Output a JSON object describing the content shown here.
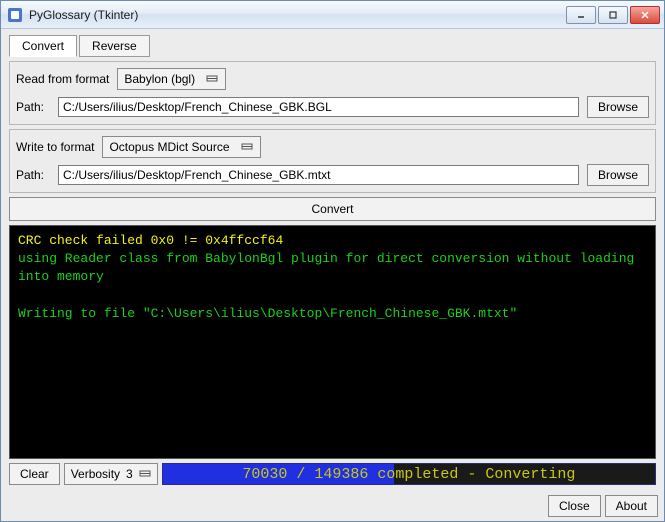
{
  "window": {
    "title": "PyGlossary (Tkinter)"
  },
  "tabs": {
    "convert": "Convert",
    "reverse": "Reverse"
  },
  "read": {
    "label": "Read from format",
    "format": "Babylon (bgl)",
    "path_label": "Path:",
    "path": "C:/Users/ilius/Desktop/French_Chinese_GBK.BGL",
    "browse": "Browse"
  },
  "write": {
    "label": "Write to format",
    "format": "Octopus MDict Source",
    "path_label": "Path:",
    "path": "C:/Users/ilius/Desktop/French_Chinese_GBK.mtxt",
    "browse": "Browse"
  },
  "convert_button": "Convert",
  "console": {
    "line1": "CRC check failed 0x0 != 0x4ffccf64",
    "line2": "using Reader class from BabylonBgl plugin for direct conversion without loading into memory",
    "line3": "Writing to file \"C:\\Users\\ilius\\Desktop\\French_Chinese_GBK.mtxt\""
  },
  "bottom": {
    "clear": "Clear",
    "verbosity_label": "Verbosity",
    "verbosity_value": "3",
    "progress_text": "70030 / 149386 completed - Converting",
    "progress_percent": 47
  },
  "footer": {
    "close": "Close",
    "about": "About"
  }
}
